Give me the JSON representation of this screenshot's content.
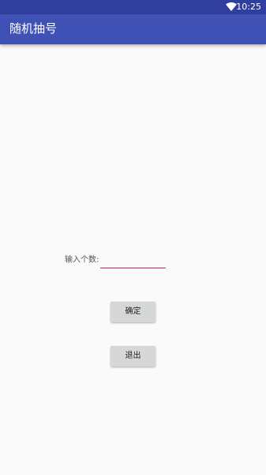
{
  "status_bar": {
    "time": "10:25",
    "wifi_icon": "wifi-icon"
  },
  "app_bar": {
    "title": "随机抽号"
  },
  "form": {
    "label": "输入个数:",
    "input_value": "",
    "input_placeholder": ""
  },
  "buttons": {
    "confirm": "确定",
    "exit": "退出"
  },
  "colors": {
    "status_bar": "#303f9f",
    "app_bar": "#3f51b5",
    "accent": "#d81b60",
    "button": "#d6d7d7",
    "background": "#fafafa"
  }
}
